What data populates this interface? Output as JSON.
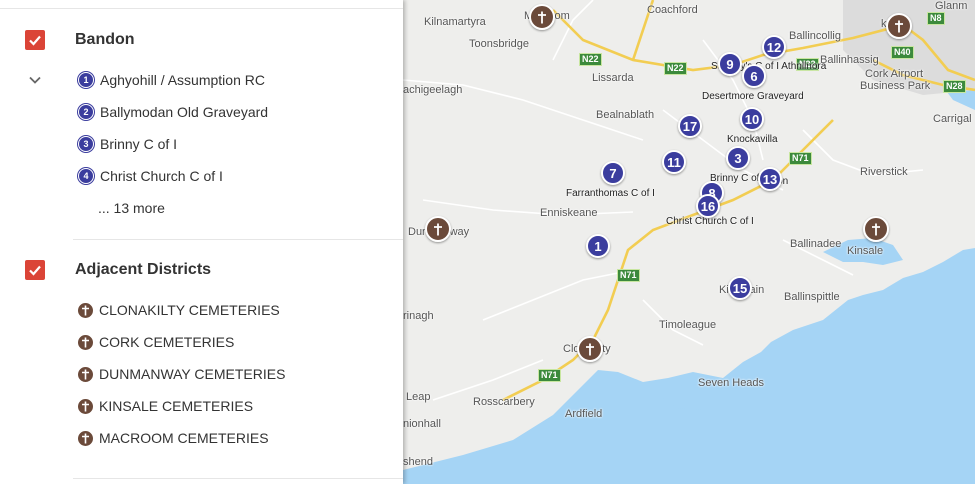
{
  "sidebar": {
    "bandon": {
      "title": "Bandon",
      "items": [
        {
          "num": "1",
          "label": "Aghyohill / Assumption RC"
        },
        {
          "num": "2",
          "label": "Ballymodan Old Graveyard"
        },
        {
          "num": "3",
          "label": "Brinny C of I"
        },
        {
          "num": "4",
          "label": "Christ Church C of I"
        }
      ],
      "more": "... 13 more"
    },
    "adjacent": {
      "title": "Adjacent Districts",
      "items": [
        {
          "label": "CLONAKILTY CEMETERIES"
        },
        {
          "label": "CORK CEMETERIES"
        },
        {
          "label": "DUNMANWAY CEMETERIES"
        },
        {
          "label": "KINSALE CEMETERIES"
        },
        {
          "label": "MACROOM CEMETERIES"
        }
      ]
    }
  },
  "map": {
    "labels": {
      "kilnamartyra": "Kilnamartyra",
      "macroom": "Macroom",
      "coachford": "Coachford",
      "ballincollig": "Ballincollig",
      "toonsbridge": "Toonsbridge",
      "lissarda": "Lissarda",
      "ballinhassig": "Ballinhassig",
      "cork_airport": "Cork Airport",
      "business_park": "Business Park",
      "achigeelagh": "achigeelagh",
      "bealnablath": "Bealnablath",
      "knockavilla": "Knockavilla",
      "carrigaline": "Carrigal",
      "riverstick": "Riverstick",
      "enniskeane": "Enniskeane",
      "dunmanway": "Dunmanway",
      "ballinadee": "Ballinadee",
      "kinsale": "Kinsale",
      "kilbrittain": "Kilbrittain",
      "ballinspittle": "Ballinspittle",
      "timoleague": "Timoleague",
      "rinagh": "rinagh",
      "clonakilty": "Clonakilty",
      "seven_heads": "Seven Heads",
      "leap": "Leap",
      "rosscarbery": "Rosscarbery",
      "ardfield": "Ardfield",
      "unionhall": "nionhall",
      "skibbereen": "shend",
      "glanmire": "Glanm",
      "cork": "k",
      "innishannon": "nnon"
    },
    "place_labels": {
      "stmarys": "St Mary's C of I Athnllnora",
      "desertmore": "Desertmore Graveyard",
      "brinny": "Brinny C of I",
      "farranthomas": "Farranthomas C of I",
      "christchurch": "Christ Church C of I"
    },
    "roads": [
      "N22",
      "N22",
      "N22",
      "N8",
      "N40",
      "N28",
      "N71",
      "N71",
      "N71"
    ],
    "markers": [
      "1",
      "3",
      "6",
      "7",
      "8",
      "9",
      "10",
      "11",
      "12",
      "13",
      "15",
      "16",
      "17"
    ]
  }
}
